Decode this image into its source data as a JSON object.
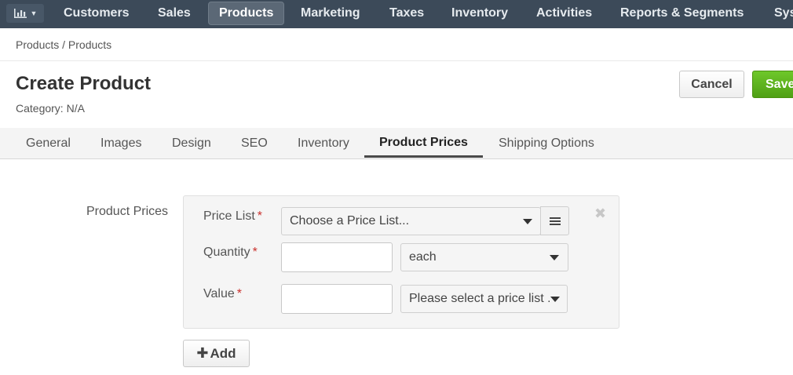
{
  "nav": {
    "items": [
      "Customers",
      "Sales",
      "Products",
      "Marketing",
      "Taxes",
      "Inventory",
      "Activities",
      "Reports & Segments",
      "Sys"
    ],
    "active": "Products",
    "menu_icon": "bar-chart-icon"
  },
  "breadcrumb": "Products / Products",
  "header": {
    "title": "Create Product",
    "subtitle": "Category: N/A",
    "cancel_label": "Cancel",
    "save_label": "Save"
  },
  "tabs": [
    "General",
    "Images",
    "Design",
    "SEO",
    "Inventory",
    "Product Prices",
    "Shipping Options"
  ],
  "active_tab": "Product Prices",
  "form": {
    "section_label": "Product Prices",
    "price_list_label": "Price List",
    "price_list_placeholder": "Choose a Price List...",
    "quantity_label": "Quantity",
    "quantity_value": "",
    "unit_value": "each",
    "value_label": "Value",
    "value_value": "",
    "currency_placeholder": "Please select a price list ...",
    "required_mark": "*",
    "close_glyph": "✖",
    "add_label": "Add"
  },
  "colors": {
    "nav_bg": "#3c4a59",
    "save_green": "#5bb31c",
    "required": "#c9302c"
  }
}
